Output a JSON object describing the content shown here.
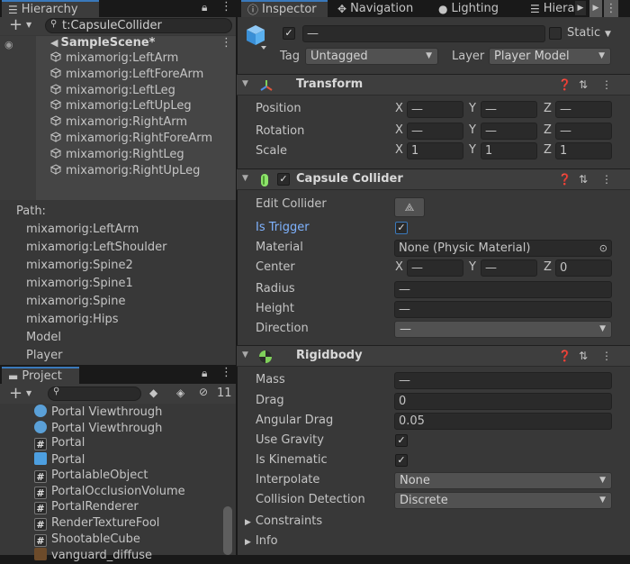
{
  "hierarchy": {
    "tab_label": "Hierarchy",
    "search_value": "t:CapsuleCollider",
    "scene_name": "SampleScene*",
    "items": [
      "mixamorig:LeftArm",
      "mixamorig:LeftForeArm",
      "mixamorig:LeftLeg",
      "mixamorig:LeftUpLeg",
      "mixamorig:RightArm",
      "mixamorig:RightForeArm",
      "mixamorig:RightLeg",
      "mixamorig:RightUpLeg"
    ],
    "path_label": "Path:",
    "path_items": [
      "mixamorig:LeftArm",
      "mixamorig:LeftShoulder",
      "mixamorig:Spine2",
      "mixamorig:Spine1",
      "mixamorig:Spine",
      "mixamorig:Hips",
      "Model",
      "Player"
    ]
  },
  "project": {
    "tab_label": "Project",
    "hidden_count": "11",
    "items": [
      {
        "label": "Portal Viewthrough",
        "icon": "sphere-icon"
      },
      {
        "label": "Portal Viewthrough",
        "icon": "sphere-icon"
      },
      {
        "label": "Portal",
        "icon": "script-icon"
      },
      {
        "label": "Portal",
        "icon": "prefab-icon"
      },
      {
        "label": "PortalableObject",
        "icon": "script-icon"
      },
      {
        "label": "PortalOcclusionVolume",
        "icon": "script-icon"
      },
      {
        "label": "PortalRenderer",
        "icon": "script-icon"
      },
      {
        "label": "RenderTextureFool",
        "icon": "script-icon"
      },
      {
        "label": "ShootableCube",
        "icon": "script-icon"
      },
      {
        "label": "vanguard_diffuse",
        "icon": "texture-icon"
      }
    ]
  },
  "tabs": {
    "inspector": "Inspector",
    "navigation": "Navigation",
    "lighting": "Lighting",
    "hierarchy2": "Hierar"
  },
  "object": {
    "name": "—",
    "static_label": "Static",
    "tag_label": "Tag",
    "tag_value": "Untagged",
    "layer_label": "Layer",
    "layer_value": "Player Model"
  },
  "transform": {
    "title": "Transform",
    "position_label": "Position",
    "rotation_label": "Rotation",
    "scale_label": "Scale",
    "x": "X",
    "y": "Y",
    "z": "Z",
    "position": [
      "—",
      "—",
      "—"
    ],
    "rotation": [
      "—",
      "—",
      "—"
    ],
    "scale": [
      "1",
      "1",
      "1"
    ]
  },
  "capsule": {
    "title": "Capsule Collider",
    "edit_collider_label": "Edit Collider",
    "is_trigger_label": "Is Trigger",
    "material_label": "Material",
    "material_value": "None (Physic Material)",
    "center_label": "Center",
    "center": [
      "—",
      "—",
      "0"
    ],
    "radius_label": "Radius",
    "radius_value": "—",
    "height_label": "Height",
    "height_value": "—",
    "direction_label": "Direction",
    "direction_value": "—"
  },
  "rigidbody": {
    "title": "Rigidbody",
    "mass_label": "Mass",
    "mass_value": "—",
    "drag_label": "Drag",
    "drag_value": "0",
    "angular_drag_label": "Angular Drag",
    "angular_drag_value": "0.05",
    "use_gravity_label": "Use Gravity",
    "is_kinematic_label": "Is Kinematic",
    "interpolate_label": "Interpolate",
    "interpolate_value": "None",
    "collision_label": "Collision Detection",
    "collision_value": "Discrete",
    "constraints_label": "Constraints",
    "info_label": "Info"
  },
  "colors": {
    "accent": "#3a79bb",
    "link_label": "#7fb3ff",
    "panel": "#383838",
    "header": "#3e3e3e"
  }
}
